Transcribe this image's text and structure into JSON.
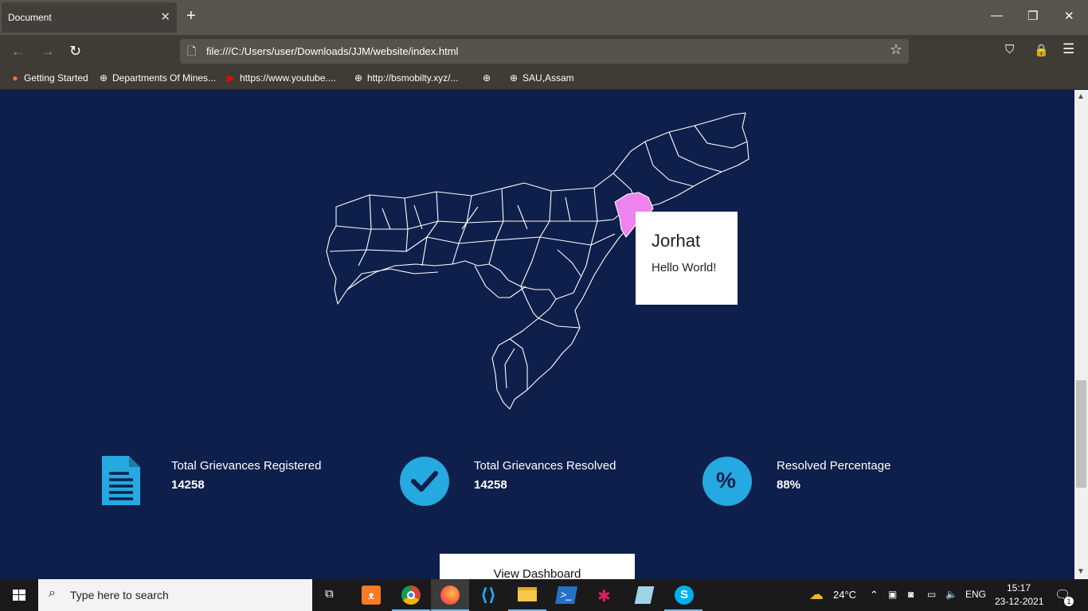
{
  "browser": {
    "tab_title": "Document",
    "url": "file:///C:/Users/user/Downloads/JJM/website/index.html",
    "bookmarks": [
      {
        "label": "Getting Started",
        "icon": "firefox-icon"
      },
      {
        "label": "Departments Of Mines...",
        "icon": "globe-icon"
      },
      {
        "label": "https://www.youtube....",
        "icon": "youtube-icon"
      },
      {
        "label": "http://bsmobilty.xyz/...",
        "icon": "globe-icon"
      },
      {
        "label": "",
        "icon": "globe-icon"
      },
      {
        "label": "SAU,Assam",
        "icon": "globe-icon"
      }
    ]
  },
  "map": {
    "highlight_color": "#ee82ee",
    "tooltip": {
      "title": "Jorhat",
      "body": "Hello World!"
    }
  },
  "stats": [
    {
      "label": "Total Grievances Registered",
      "value": "14258",
      "icon": "document-icon"
    },
    {
      "label": "Total Grievances Resolved",
      "value": "14258",
      "icon": "checkmark-icon"
    },
    {
      "label": "Resolved Percentage",
      "value": "88%",
      "icon": "percent-icon"
    }
  ],
  "dashboard_button": "View Dashboard",
  "taskbar": {
    "search_placeholder": "Type here to search",
    "weather": "24°C",
    "language": "ENG",
    "time": "15:17",
    "date": "23-12-2021",
    "notification_count": "1"
  },
  "colors": {
    "page_bg": "#0f1f4b",
    "accent": "#26a8e0"
  }
}
